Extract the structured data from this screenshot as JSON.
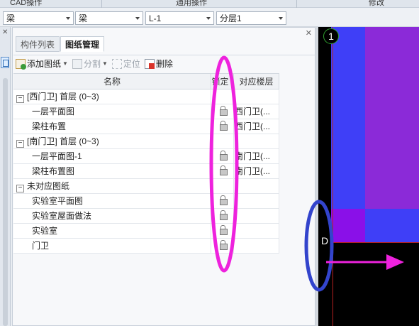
{
  "ribbon": {
    "groups": [
      "CAD操作",
      "通用操作",
      "修改"
    ]
  },
  "combos": [
    {
      "value": "梁"
    },
    {
      "value": "梁"
    },
    {
      "value": "L-1"
    },
    {
      "value": "分层1"
    }
  ],
  "panel": {
    "tabs": [
      {
        "label": "构件列表",
        "active": false
      },
      {
        "label": "图纸管理",
        "active": true
      }
    ],
    "toolbar": {
      "add_label": "添加图纸",
      "split_label": "分割",
      "locate_label": "定位",
      "delete_label": "删除"
    },
    "columns": [
      "名称",
      "锁定",
      "对应楼层"
    ],
    "rows": [
      {
        "name": "[西门卫] 首层 (0~3)",
        "group": true,
        "expander": "−",
        "locked": false,
        "floor": ""
      },
      {
        "name": "一层平面图",
        "group": false,
        "locked": true,
        "floor": "西门卫(..."
      },
      {
        "name": "梁柱布置",
        "group": false,
        "locked": true,
        "floor": "西门卫(..."
      },
      {
        "name": "[南门卫] 首层 (0~3)",
        "group": true,
        "expander": "−",
        "locked": false,
        "floor": ""
      },
      {
        "name": "一层平面图-1",
        "group": false,
        "locked": true,
        "floor": "南门卫(..."
      },
      {
        "name": "梁柱布置图",
        "group": false,
        "locked": true,
        "floor": "南门卫(..."
      },
      {
        "name": "未对应图纸",
        "group": true,
        "expander": "−",
        "locked": false,
        "floor": ""
      },
      {
        "name": "实验室平面图",
        "group": false,
        "locked": true,
        "floor": ""
      },
      {
        "name": "实验室屋面做法",
        "group": false,
        "locked": true,
        "floor": ""
      },
      {
        "name": "实验室",
        "group": false,
        "locked": true,
        "floor": ""
      },
      {
        "name": "门卫",
        "group": false,
        "locked": true,
        "floor": ""
      }
    ]
  },
  "canvas": {
    "axis_labels": [
      "1",
      "D"
    ]
  },
  "annotations": {
    "magenta": "#ee22dd",
    "blue": "#3344cc"
  }
}
